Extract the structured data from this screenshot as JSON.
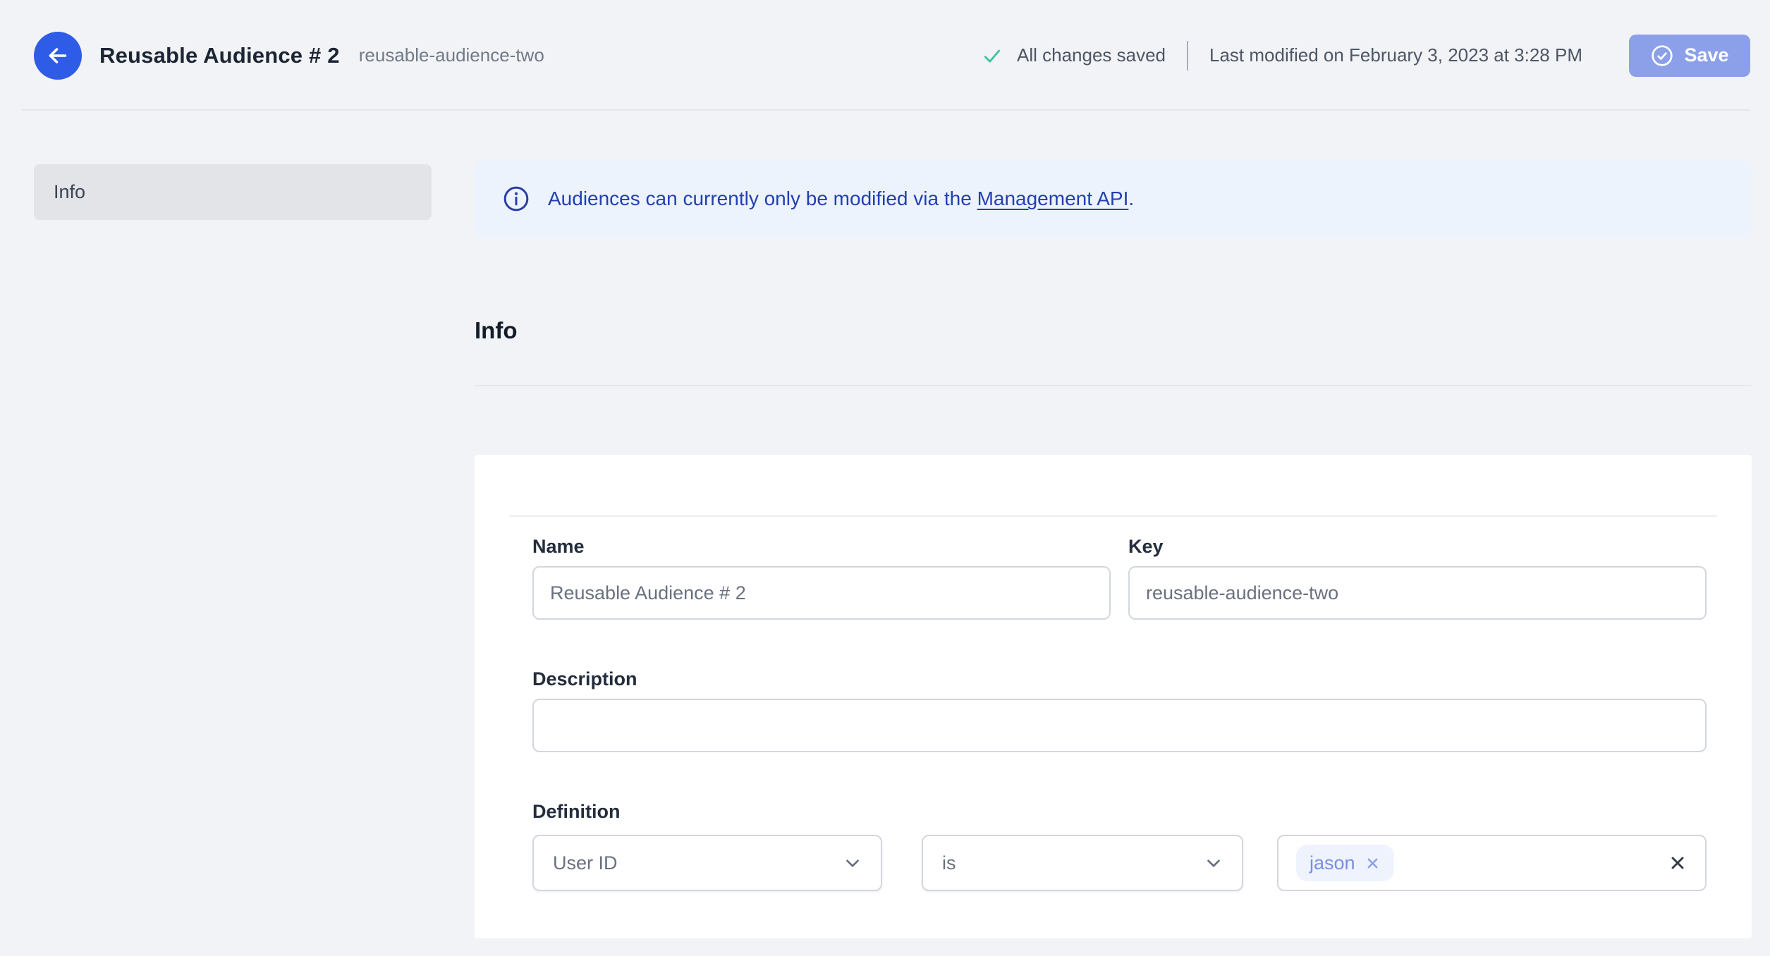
{
  "header": {
    "title": "Reusable Audience # 2",
    "slug": "reusable-audience-two",
    "saved_status": "All changes saved",
    "last_modified": "Last modified on February 3, 2023 at 3:28 PM",
    "save_label": "Save"
  },
  "sidebar": {
    "items": [
      {
        "label": "Info",
        "active": true
      }
    ]
  },
  "banner": {
    "text_before_link": "Audiences can currently only be modified via the ",
    "link_text": "Management API",
    "text_after_link": "."
  },
  "section": {
    "heading": "Info"
  },
  "form": {
    "name": {
      "label": "Name",
      "value": "Reusable Audience # 2"
    },
    "key": {
      "label": "Key",
      "value": "reusable-audience-two"
    },
    "description": {
      "label": "Description",
      "value": ""
    },
    "definition": {
      "label": "Definition",
      "field": {
        "selected": "User ID"
      },
      "operator": {
        "selected": "is"
      },
      "values": [
        "jason"
      ]
    }
  },
  "icons": {
    "back_button": "arrow-left",
    "saved_status": "check",
    "save_button": "circle-check",
    "banner": "info-circle",
    "selects": "chevron-down",
    "remove_value": "x",
    "clear_values": "x"
  },
  "colors": {
    "page_bg": "#f2f3f6",
    "accent_blue": "#2e5ce6",
    "save_button_bg": "#8ba0e8",
    "success_green": "#3fc1a1",
    "banner_bg": "#edf3fd",
    "banner_text": "#2340b0",
    "pill_bg": "#eef3fd",
    "pill_text": "#7a8ee2",
    "input_border": "#d3d7dc",
    "sidebar_item_bg": "#e2e4e8"
  }
}
